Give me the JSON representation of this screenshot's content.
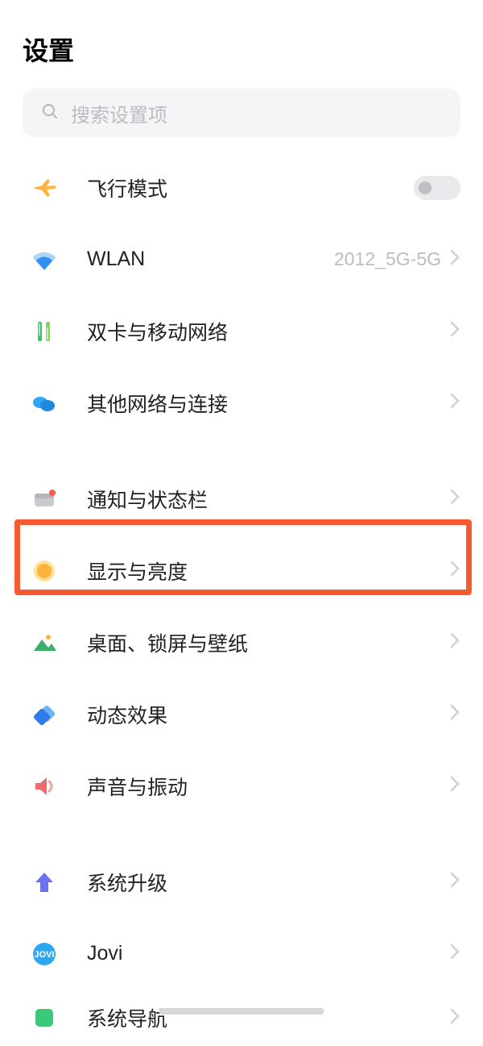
{
  "header": {
    "title": "设置"
  },
  "search": {
    "placeholder": "搜索设置项"
  },
  "items": {
    "airplane": {
      "label": "飞行模式"
    },
    "wlan": {
      "label": "WLAN",
      "value": "2012_5G-5G"
    },
    "dualsim": {
      "label": "双卡与移动网络"
    },
    "othernet": {
      "label": "其他网络与连接"
    },
    "notify": {
      "label": "通知与状态栏"
    },
    "display": {
      "label": "显示与亮度"
    },
    "wallpaper": {
      "label": "桌面、锁屏与壁纸"
    },
    "dynamic": {
      "label": "动态效果"
    },
    "sound": {
      "label": "声音与振动"
    },
    "upgrade": {
      "label": "系统升级"
    },
    "jovi": {
      "label": "Jovi"
    },
    "nav": {
      "label": "系统导航"
    }
  }
}
